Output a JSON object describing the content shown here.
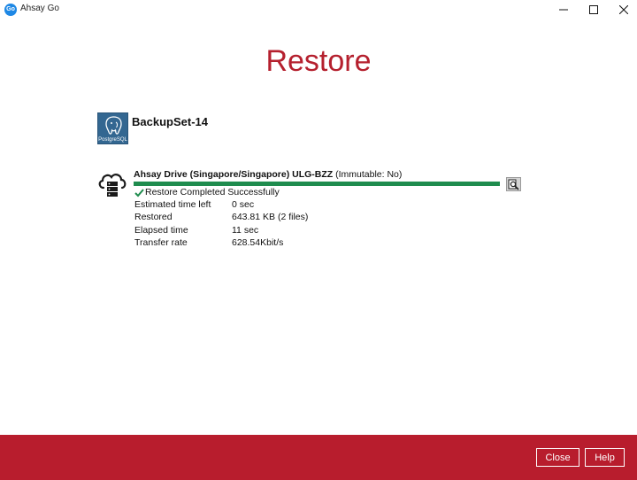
{
  "window": {
    "title": "Ahsay Go",
    "icon_text": "Go"
  },
  "page": {
    "title": "Restore"
  },
  "backup_set": {
    "name": "BackupSet-14",
    "logo_text": "PostgreSQL",
    "icon": "postgresql-icon"
  },
  "destination": {
    "name": "Ahsay Drive (Singapore/Singapore) ULG-BZZ",
    "suffix": " (Immutable: No)",
    "icon": "cloud-server-icon",
    "progress_fraction": 1.0,
    "progress_color": "#1f8c4e",
    "status": "Restore Completed Successfully",
    "details": [
      {
        "label": "Estimated time left",
        "value": "0 sec"
      },
      {
        "label": "Restored",
        "value": "643.81 KB (2 files)"
      },
      {
        "label": "Elapsed time",
        "value": "11 sec"
      },
      {
        "label": "Transfer rate",
        "value": "628.54Kbit/s"
      }
    ]
  },
  "footer": {
    "close_label": "Close",
    "help_label": "Help",
    "background": "#b81d2d"
  },
  "colors": {
    "title": "#b5202e",
    "accent": "#b81d2d"
  }
}
